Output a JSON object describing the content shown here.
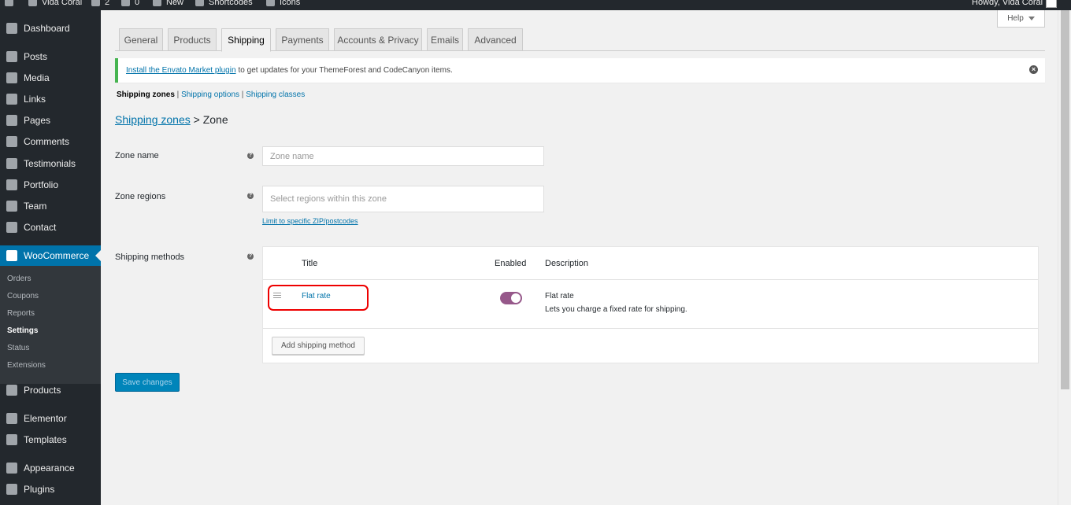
{
  "adminbar": {
    "site_name": "Vida Coral",
    "updates_count": "2",
    "comments_count": "0",
    "new_label": "New",
    "shortcodes_label": "Shortcodes",
    "icons_label": "Icons",
    "howdy": "Howdy, Vida Coral"
  },
  "sidebar": {
    "items": [
      {
        "label": "Dashboard",
        "icon": "dashboard-icon"
      },
      {
        "label": "Posts",
        "icon": "pin-icon"
      },
      {
        "label": "Media",
        "icon": "media-icon"
      },
      {
        "label": "Links",
        "icon": "link-icon"
      },
      {
        "label": "Pages",
        "icon": "page-icon"
      },
      {
        "label": "Comments",
        "icon": "comment-icon"
      },
      {
        "label": "Testimonials",
        "icon": "quote-icon"
      },
      {
        "label": "Portfolio",
        "icon": "folder-icon"
      },
      {
        "label": "Team",
        "icon": "team-icon"
      },
      {
        "label": "Contact",
        "icon": "mail-icon"
      },
      {
        "label": "WooCommerce",
        "icon": "woo-icon"
      },
      {
        "label": "Products",
        "icon": "box-icon"
      },
      {
        "label": "Elementor",
        "icon": "elementor-icon"
      },
      {
        "label": "Templates",
        "icon": "folder-icon"
      },
      {
        "label": "Appearance",
        "icon": "brush-icon"
      },
      {
        "label": "Plugins",
        "icon": "plug-icon"
      }
    ],
    "woo_submenu": [
      "Orders",
      "Coupons",
      "Reports",
      "Settings",
      "Status",
      "Extensions"
    ],
    "current_submenu": "Settings"
  },
  "help_label": "Help",
  "tabs": [
    "General",
    "Products",
    "Shipping",
    "Payments",
    "Accounts & Privacy",
    "Emails",
    "Advanced"
  ],
  "active_tab": "Shipping",
  "notice": {
    "link_text": "Install the Envato Market plugin",
    "text": "to get updates for your ThemeForest and CodeCanyon items."
  },
  "subnav": {
    "current": "Shipping zones",
    "sep": "|",
    "links": [
      "Shipping options",
      "Shipping classes"
    ]
  },
  "heading": {
    "link": "Shipping zones",
    "separator": ">",
    "current": "Zone"
  },
  "form": {
    "zone_name_label": "Zone name",
    "zone_name_placeholder": "Zone name",
    "zone_regions_label": "Zone regions",
    "zone_regions_placeholder": "Select regions within this zone",
    "limit_link": "Limit to specific ZIP/postcodes",
    "shipping_methods_label": "Shipping methods"
  },
  "methods_table": {
    "headers": {
      "title": "Title",
      "enabled": "Enabled",
      "description": "Description"
    },
    "rows": [
      {
        "title": "Flat rate",
        "enabled": true,
        "description_title": "Flat rate",
        "description_text": "Lets you charge a fixed rate for shipping."
      }
    ],
    "add_button": "Add shipping method"
  },
  "save_button": "Save changes",
  "colors": {
    "accent": "#0073aa",
    "woo_purple": "#96588a",
    "highlight_red": "#e00000",
    "notice_green": "#46b450"
  }
}
